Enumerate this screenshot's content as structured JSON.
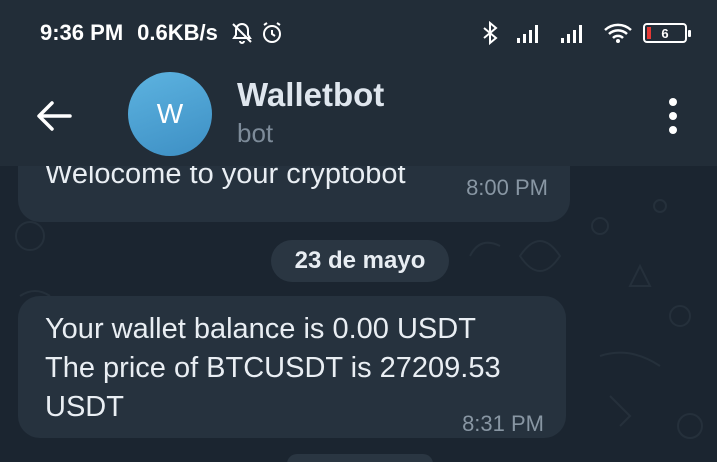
{
  "status_bar": {
    "time": "9:36 PM",
    "network_speed": "0.6KB/s",
    "battery_level": "6",
    "icons": [
      "notifications-muted-icon",
      "alarm-icon",
      "bluetooth-icon",
      "signal-icon",
      "signal-icon",
      "wifi-icon",
      "battery-icon"
    ]
  },
  "header": {
    "back_icon": "arrow-left-icon",
    "avatar_letter": "W",
    "title": "Walletbot",
    "subtitle": "bot",
    "menu_icon": "more-vertical-icon"
  },
  "messages": [
    {
      "lines": [
        "Welocome to your cryptobot"
      ],
      "time": "8:00 PM"
    },
    {
      "lines": [
        "Your wallet balance is 0.00 USDT",
        "The price of BTCUSDT is 27209.53",
        "USDT"
      ],
      "time": "8:31 PM"
    }
  ],
  "date_separator": "23 de mayo",
  "colors": {
    "background": "#1b2530",
    "header": "#222d38",
    "bubble": "#26323e",
    "avatar": "#4aa0d5",
    "battery_low": "#e53935"
  }
}
